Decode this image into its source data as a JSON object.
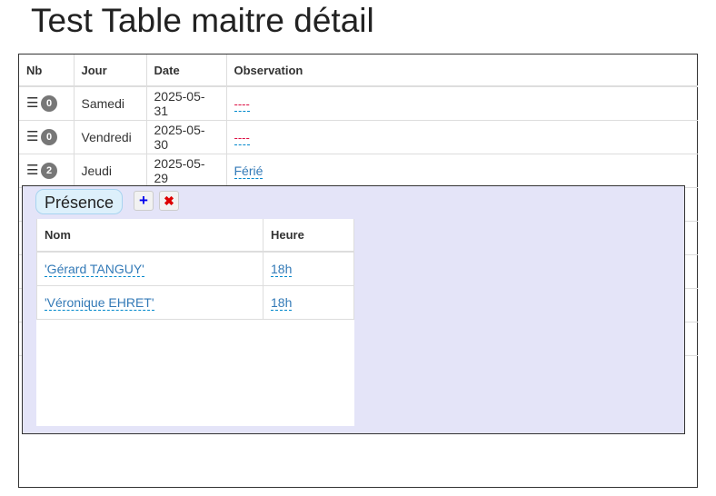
{
  "page": {
    "title": "Test Table maitre détail"
  },
  "master": {
    "columns": {
      "nb": "Nb",
      "jour": "Jour",
      "date": "Date",
      "observation": "Observation"
    },
    "rows": [
      {
        "count": "0",
        "jour": "Samedi",
        "date": "2025-05-31",
        "observation": "----"
      },
      {
        "count": "0",
        "jour": "Vendredi",
        "date": "2025-05-30",
        "observation": "----"
      },
      {
        "count": "2",
        "jour": "Jeudi",
        "date": "2025-05-29",
        "observation": "Férié"
      }
    ],
    "icons": {
      "row_menu": "hamburger-icon"
    }
  },
  "detail": {
    "title": "Présence",
    "add_label": "+",
    "delete_label": "✖",
    "icons": {
      "add": "plus-icon",
      "delete": "close-icon"
    },
    "columns": {
      "nom": "Nom",
      "heure": "Heure"
    },
    "rows": [
      {
        "nom": "'Gérard TANGUY'",
        "heure": "18h"
      },
      {
        "nom": "'Véronique EHRET'",
        "heure": "18h"
      }
    ]
  },
  "colors": {
    "panel_bg": "#e4e4f8",
    "link": "#337ab7",
    "empty_value": "#dd1144",
    "badge": "#777777",
    "add_icon": "#0000ee",
    "delete_icon": "#dd0000"
  }
}
